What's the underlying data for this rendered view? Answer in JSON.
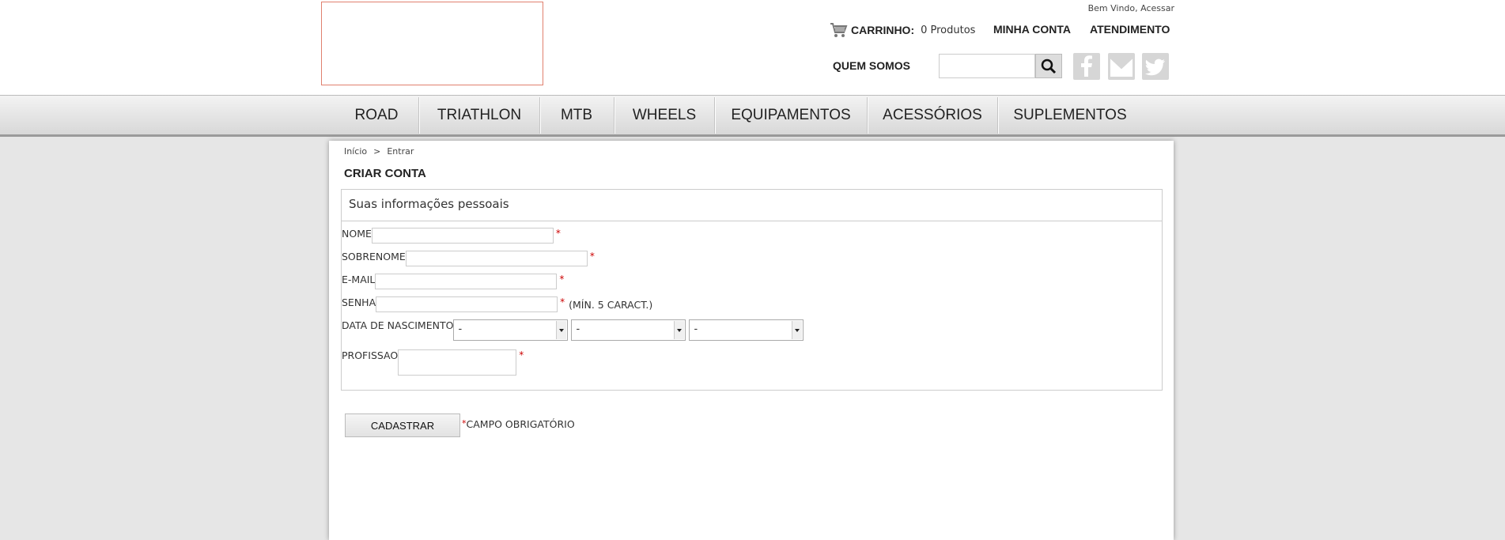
{
  "header": {
    "welcome_text": "Bem Vindo,",
    "login_link": "Acessar",
    "cart_label": "CARRINHO:",
    "cart_count": "0 Produtos",
    "my_account": "MINHA CONTA",
    "support": "ATENDIMENTO",
    "about": "QUEM SOMOS",
    "search_placeholder": ""
  },
  "nav": {
    "items": [
      {
        "label": "ROAD"
      },
      {
        "label": "TRIATHLON"
      },
      {
        "label": "MTB"
      },
      {
        "label": "WHEELS"
      },
      {
        "label": "EQUIPAMENTOS"
      },
      {
        "label": "ACESSÓRIOS"
      },
      {
        "label": "SUPLEMENTOS"
      }
    ]
  },
  "breadcrumb": {
    "home": "Início",
    "separator": ">",
    "current": "Entrar"
  },
  "page_title": "CRIAR CONTA",
  "form": {
    "section_title": "Suas informações pessoais",
    "fields": {
      "nome": {
        "label": "NOME",
        "value": "",
        "required": "*"
      },
      "sobrenome": {
        "label": "SOBRENOME",
        "value": "",
        "required": "*"
      },
      "email": {
        "label": "E-MAIL",
        "value": "",
        "required": "*"
      },
      "senha": {
        "label": "SENHA",
        "value": "",
        "required": "*",
        "hint": "(MÍN. 5 CARACT.)"
      },
      "nascimento": {
        "label": "DATA DE NASCIMENTO",
        "day": "-",
        "month": "-",
        "year": "-"
      },
      "profissao": {
        "label": "PROFISSAO",
        "value": "",
        "required": "*"
      }
    },
    "submit_label": "CADASTRAR",
    "required_marker": "*",
    "required_note": "CAMPO OBRIGATÓRIO"
  },
  "colors": {
    "required": "#cc0000",
    "logo_border": "#e0806e"
  }
}
